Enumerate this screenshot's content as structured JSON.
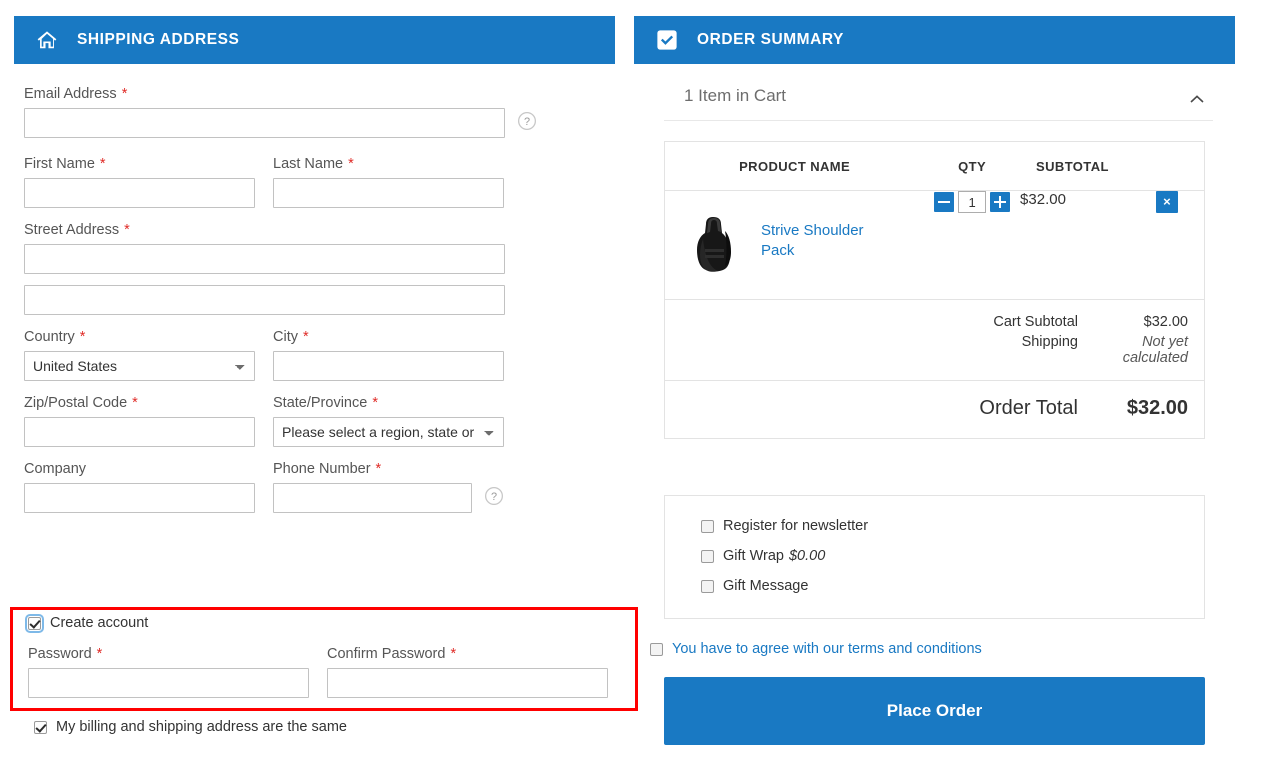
{
  "shipping": {
    "header_title": "SHIPPING ADDRESS",
    "header_icon": "home-icon",
    "fields": {
      "email": {
        "label": "Email Address",
        "required": "*",
        "value": "",
        "hint_icon": "question-circle-icon"
      },
      "first_name": {
        "label": "First Name",
        "required": "*",
        "value": ""
      },
      "last_name": {
        "label": "Last Name",
        "required": "*",
        "value": ""
      },
      "street": {
        "label": "Street Address",
        "required": "*",
        "value": "",
        "value2": ""
      },
      "country": {
        "label": "Country",
        "required": "*",
        "selected": "United States"
      },
      "city": {
        "label": "City",
        "required": "*",
        "value": ""
      },
      "zip": {
        "label": "Zip/Postal Code",
        "required": "*",
        "value": ""
      },
      "state": {
        "label": "State/Province",
        "required": "*",
        "selected": "Please select a region, state or province."
      },
      "company": {
        "label": "Company",
        "required": "",
        "value": ""
      },
      "phone": {
        "label": "Phone Number",
        "required": "*",
        "value": "",
        "hint_icon": "question-circle-icon"
      }
    },
    "create_account": {
      "label": "Create account",
      "checked": true,
      "password": {
        "label": "Password",
        "required": "*",
        "value": ""
      },
      "confirm_password": {
        "label": "Confirm Password",
        "required": "*",
        "value": ""
      }
    },
    "billing_same": {
      "label": "My billing and shipping address are the same",
      "checked": true
    }
  },
  "summary": {
    "header_title": "ORDER SUMMARY",
    "header_icon": "check-square-icon",
    "items_in_cart": "1 Item in Cart",
    "collapse_icon": "chevron-up-icon",
    "table": {
      "columns": [
        "PRODUCT NAME",
        "QTY",
        "SUBTOTAL"
      ],
      "rows": [
        {
          "thumb": "backpack-thumbnail",
          "name": "Strive Shoulder Pack",
          "qty": "1",
          "decrease_icon": "minus-icon",
          "increase_icon": "plus-icon",
          "subtotal": "$32.00",
          "remove_icon": "close-icon",
          "remove_label": "×"
        }
      ]
    },
    "totals": [
      {
        "label": "Cart Subtotal",
        "value": "$32.00",
        "italic": false
      },
      {
        "label": "Shipping",
        "value": "Not yet calculated",
        "italic": true
      }
    ],
    "grand_total": {
      "label": "Order Total",
      "value": "$32.00"
    },
    "options": [
      {
        "label": "Register for newsletter",
        "price": "",
        "checked": false
      },
      {
        "label": "Gift Wrap",
        "price": "$0.00",
        "checked": false
      },
      {
        "label": "Gift Message",
        "price": "",
        "checked": false
      }
    ],
    "terms": {
      "label": "You have to agree with our terms and conditions",
      "checked": false
    },
    "place_order_label": "Place Order"
  },
  "annotation": {
    "highlight_color": "#ff0000"
  },
  "colors": {
    "accent": "#1979c3",
    "required": "#e02b27",
    "link": "#1979c3"
  }
}
